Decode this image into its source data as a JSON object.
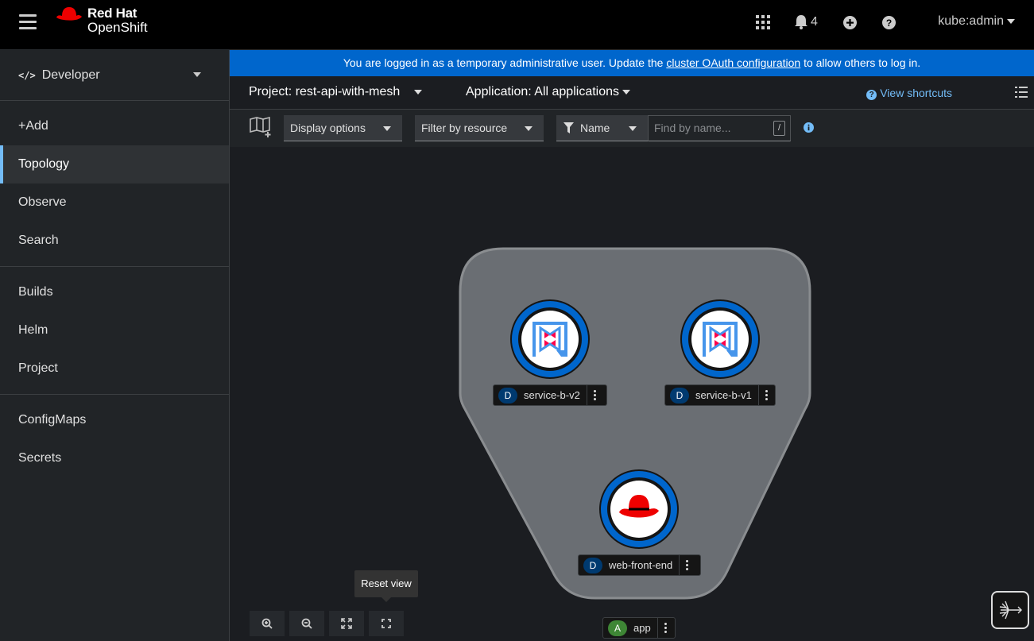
{
  "masthead": {
    "brand_line1": "Red Hat",
    "brand_line2": "OpenShift",
    "notifications_count": "4",
    "user": "kube:admin"
  },
  "sidebar": {
    "perspective": "Developer",
    "groups": [
      [
        "+Add",
        "Topology",
        "Observe",
        "Search"
      ],
      [
        "Builds",
        "Helm",
        "Project"
      ],
      [
        "ConfigMaps",
        "Secrets"
      ]
    ]
  },
  "banner": {
    "text_before": "You are logged in as a temporary administrative user. Update the ",
    "link": "cluster OAuth configuration",
    "text_after": " to allow others to log in."
  },
  "project_bar": {
    "project": "Project: rest-api-with-mesh",
    "application": "Application: All applications",
    "shortcuts": "View shortcuts"
  },
  "filter_bar": {
    "display_options": "Display options",
    "filter_by_resource": "Filter by resource",
    "filter_type": "Name",
    "find_placeholder": "Find by name...",
    "slash": "/"
  },
  "topology": {
    "nodes": [
      {
        "badge": "D",
        "name": "service-b-v2"
      },
      {
        "badge": "D",
        "name": "service-b-v1"
      },
      {
        "badge": "D",
        "name": "web-front-end"
      }
    ],
    "group": {
      "badge": "A",
      "name": "app"
    },
    "tooltip": "Reset view"
  },
  "colors": {
    "banner": "#0066cc",
    "node_ring": "#0066cc",
    "link": "#73bcf7",
    "group_fill": "#6a6e73"
  }
}
